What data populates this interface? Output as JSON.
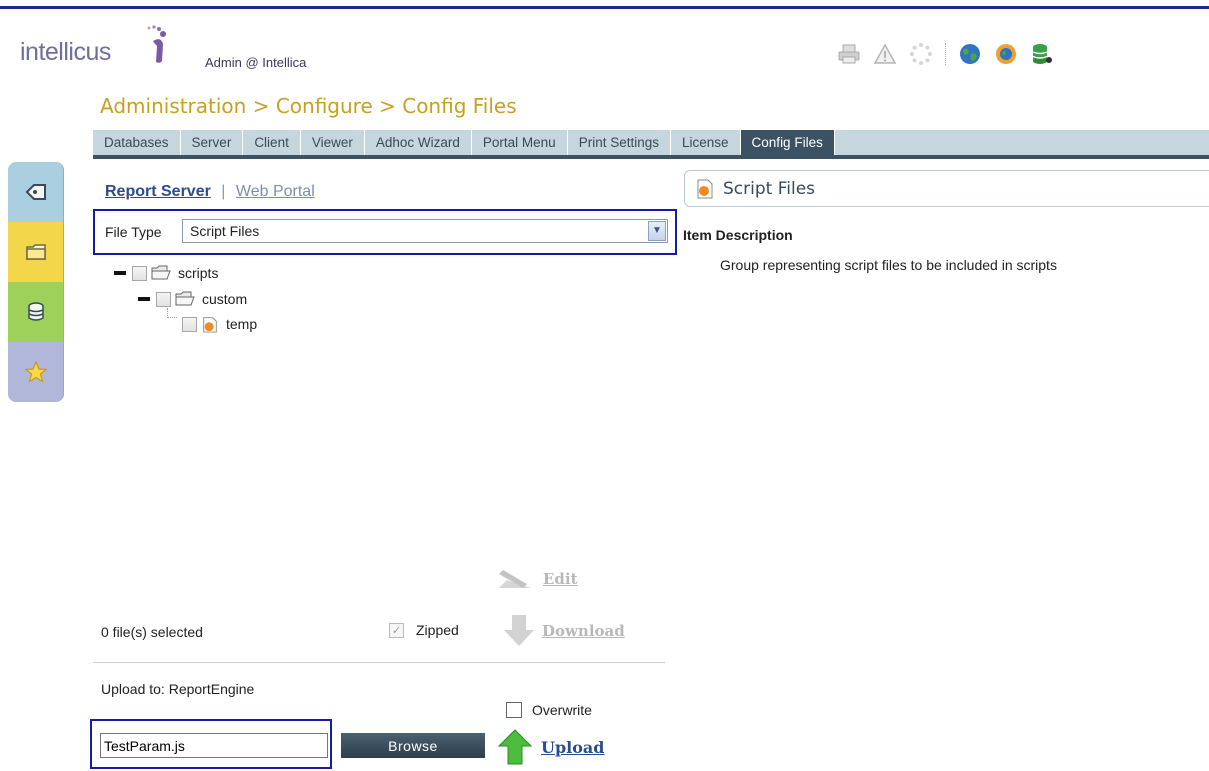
{
  "header": {
    "logo_text": "intellicus",
    "user": "Admin @ Intellica",
    "breadcrumb": "Administration > Configure > Config Files",
    "toolbar_icons": [
      "print-icon",
      "warning-icon",
      "loading-icon",
      "globe-icon",
      "globe-settings-icon",
      "database-icon"
    ]
  },
  "tabs": [
    {
      "label": "Databases"
    },
    {
      "label": "Server"
    },
    {
      "label": "Client"
    },
    {
      "label": "Viewer"
    },
    {
      "label": "Adhoc Wizard"
    },
    {
      "label": "Portal Menu"
    },
    {
      "label": "Print Settings"
    },
    {
      "label": "License"
    },
    {
      "label": "Config Files",
      "active": true
    }
  ],
  "left_strip_icons": [
    "tag-icon",
    "folder-icon",
    "database-icon",
    "star-icon"
  ],
  "source_tabs": {
    "active": "Report Server",
    "separator": "|",
    "inactive": "Web Portal"
  },
  "file_type": {
    "label": "File Type",
    "value": "Script Files"
  },
  "tree": [
    {
      "label": "scripts",
      "level": 0,
      "icon": "folder-icon"
    },
    {
      "label": "custom",
      "level": 1,
      "icon": "folder-icon"
    },
    {
      "label": "temp",
      "level": 2,
      "icon": "script-file-icon"
    }
  ],
  "actions": {
    "edit": "Edit",
    "download": "Download",
    "upload": "Upload"
  },
  "selection": {
    "count_text": "0 file(s) selected",
    "zipped_label": "Zipped",
    "zipped_checked": true
  },
  "upload": {
    "upload_to": "Upload to: ReportEngine",
    "overwrite_label": "Overwrite",
    "overwrite_checked": false,
    "file_value": "TestParam.js",
    "browse_label": "Browse"
  },
  "right_panel": {
    "title": "Script Files",
    "item_description_title": "Item Description",
    "item_description": "Group representing script files to be included in scripts"
  },
  "colors": {
    "accent_navy": "#1c2a8a",
    "breadcrumb_gold": "#c8a020",
    "tab_bar": "#c5d6de",
    "tab_active": "#3c5162",
    "link_blue": "#2a4d8f"
  }
}
